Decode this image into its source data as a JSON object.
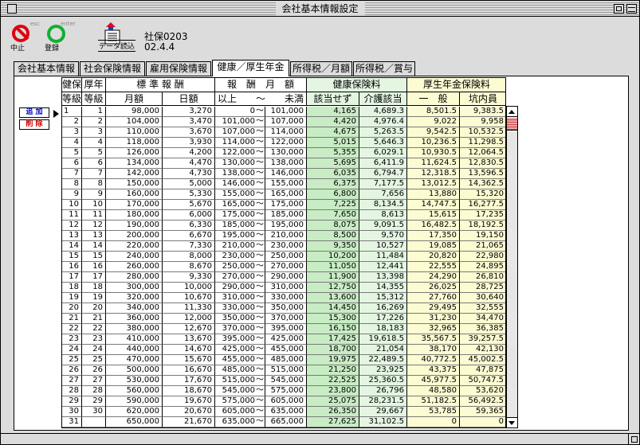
{
  "window": {
    "title": "会社基本情報設定"
  },
  "toolbar": {
    "stop": {
      "caption": "esc",
      "label": "中止"
    },
    "register": {
      "caption": "enter",
      "label": "登録"
    },
    "import": {
      "label": "データ読込"
    },
    "code": "社保0203",
    "date": "02.4.4"
  },
  "tabs": [
    {
      "label": "会社基本情報",
      "active": false
    },
    {
      "label": "社会保険情報",
      "active": false
    },
    {
      "label": "雇用保険情報",
      "active": false
    },
    {
      "label": "健康／厚生年金",
      "active": true
    },
    {
      "label": "所得税／月額",
      "active": false
    },
    {
      "label": "所得税／賞与",
      "active": false
    }
  ],
  "side_buttons": {
    "add": "追 加",
    "delete": "削 除"
  },
  "table": {
    "header_top": [
      "健保",
      "厚年",
      "標 準 報 酬",
      "報　酬　月　額",
      "健康保険料",
      "厚生年金保険料"
    ],
    "header_bottom": [
      "等級",
      "等級",
      "月額",
      "日額",
      "以上　　～　　未満",
      "該当せず",
      "介護該当",
      "一　般",
      "坑内員"
    ],
    "range_separator": "～",
    "rows": [
      [
        "1",
        "1",
        "98,000",
        "3,270",
        "0",
        "101,000",
        "4,165",
        "4,689.3",
        "8,501.5",
        "9,383.5"
      ],
      [
        "2",
        "2",
        "104,000",
        "3,470",
        "101,000",
        "107,000",
        "4,420",
        "4,976.4",
        "9,022",
        "9,958"
      ],
      [
        "3",
        "3",
        "110,000",
        "3,670",
        "107,000",
        "114,000",
        "4,675",
        "5,263.5",
        "9,542.5",
        "10,532.5"
      ],
      [
        "4",
        "4",
        "118,000",
        "3,930",
        "114,000",
        "122,000",
        "5,015",
        "5,646.3",
        "10,236.5",
        "11,298.5"
      ],
      [
        "5",
        "5",
        "126,000",
        "4,200",
        "122,000",
        "130,000",
        "5,355",
        "6,029.1",
        "10,930.5",
        "12,064.5"
      ],
      [
        "6",
        "6",
        "134,000",
        "4,470",
        "130,000",
        "138,000",
        "5,695",
        "6,411.9",
        "11,624.5",
        "12,830.5"
      ],
      [
        "7",
        "7",
        "142,000",
        "4,730",
        "138,000",
        "146,000",
        "6,035",
        "6,794.7",
        "12,318.5",
        "13,596.5"
      ],
      [
        "8",
        "8",
        "150,000",
        "5,000",
        "146,000",
        "155,000",
        "6,375",
        "7,177.5",
        "13,012.5",
        "14,362.5"
      ],
      [
        "9",
        "9",
        "160,000",
        "5,330",
        "155,000",
        "165,000",
        "6,800",
        "7,656",
        "13,880",
        "15,320"
      ],
      [
        "10",
        "10",
        "170,000",
        "5,670",
        "165,000",
        "175,000",
        "7,225",
        "8,134.5",
        "14,747.5",
        "16,277.5"
      ],
      [
        "11",
        "11",
        "180,000",
        "6,000",
        "175,000",
        "185,000",
        "7,650",
        "8,613",
        "15,615",
        "17,235"
      ],
      [
        "12",
        "12",
        "190,000",
        "6,330",
        "185,000",
        "195,000",
        "8,075",
        "9,091.5",
        "16,482.5",
        "18,192.5"
      ],
      [
        "13",
        "13",
        "200,000",
        "6,670",
        "195,000",
        "210,000",
        "8,500",
        "9,570",
        "17,350",
        "19,150"
      ],
      [
        "14",
        "14",
        "220,000",
        "7,330",
        "210,000",
        "230,000",
        "9,350",
        "10,527",
        "19,085",
        "21,065"
      ],
      [
        "15",
        "15",
        "240,000",
        "8,000",
        "230,000",
        "250,000",
        "10,200",
        "11,484",
        "20,820",
        "22,980"
      ],
      [
        "16",
        "16",
        "260,000",
        "8,670",
        "250,000",
        "270,000",
        "11,050",
        "12,441",
        "22,555",
        "24,895"
      ],
      [
        "17",
        "17",
        "280,000",
        "9,330",
        "270,000",
        "290,000",
        "11,900",
        "13,398",
        "24,290",
        "26,810"
      ],
      [
        "18",
        "18",
        "300,000",
        "10,000",
        "290,000",
        "310,000",
        "12,750",
        "14,355",
        "26,025",
        "28,725"
      ],
      [
        "19",
        "19",
        "320,000",
        "10,670",
        "310,000",
        "330,000",
        "13,600",
        "15,312",
        "27,760",
        "30,640"
      ],
      [
        "20",
        "20",
        "340,000",
        "11,330",
        "330,000",
        "350,000",
        "14,450",
        "16,269",
        "29,495",
        "32,555"
      ],
      [
        "21",
        "21",
        "360,000",
        "12,000",
        "350,000",
        "370,000",
        "15,300",
        "17,226",
        "31,230",
        "34,470"
      ],
      [
        "22",
        "22",
        "380,000",
        "12,670",
        "370,000",
        "395,000",
        "16,150",
        "18,183",
        "32,965",
        "36,385"
      ],
      [
        "23",
        "23",
        "410,000",
        "13,670",
        "395,000",
        "425,000",
        "17,425",
        "19,618.5",
        "35,567.5",
        "39,257.5"
      ],
      [
        "24",
        "24",
        "440,000",
        "14,670",
        "425,000",
        "455,000",
        "18,700",
        "21,054",
        "38,170",
        "42,130"
      ],
      [
        "25",
        "25",
        "470,000",
        "15,670",
        "455,000",
        "485,000",
        "19,975",
        "22,489.5",
        "40,772.5",
        "45,002.5"
      ],
      [
        "26",
        "26",
        "500,000",
        "16,670",
        "485,000",
        "515,000",
        "21,250",
        "23,925",
        "43,375",
        "47,875"
      ],
      [
        "27",
        "27",
        "530,000",
        "17,670",
        "515,000",
        "545,000",
        "22,525",
        "25,360.5",
        "45,977.5",
        "50,747.5"
      ],
      [
        "28",
        "28",
        "560,000",
        "18,670",
        "545,000",
        "575,000",
        "23,800",
        "26,796",
        "48,580",
        "53,620"
      ],
      [
        "29",
        "29",
        "590,000",
        "19,670",
        "575,000",
        "605,000",
        "25,075",
        "28,231.5",
        "51,182.5",
        "56,492.5"
      ],
      [
        "30",
        "30",
        "620,000",
        "20,670",
        "605,000",
        "635,000",
        "26,350",
        "29,667",
        "53,785",
        "59,365"
      ],
      [
        "31",
        "",
        "650,000",
        "21,670",
        "635,000",
        "665,000",
        "27,625",
        "31,102.5",
        "0",
        "0"
      ]
    ]
  }
}
